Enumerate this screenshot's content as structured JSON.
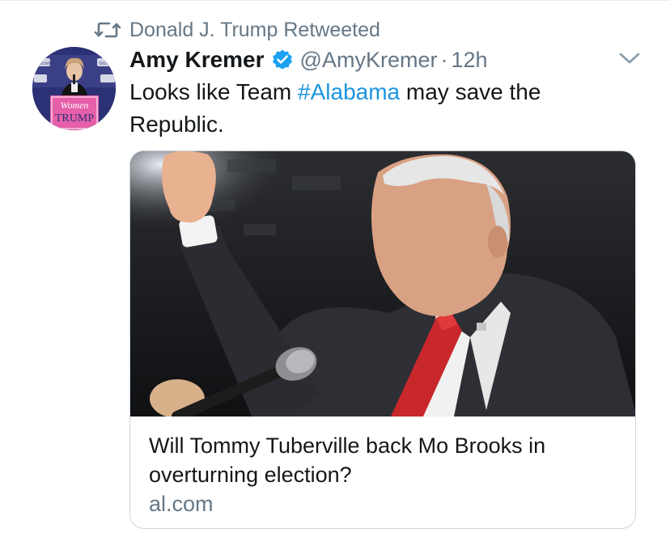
{
  "retweet_context": {
    "icon": "retweet-icon",
    "text": "Donald J. Trump Retweeted"
  },
  "author": {
    "display_name": "Amy Kremer",
    "verified_icon": "verified-badge-icon",
    "handle": "@AmyKremer",
    "separator": "·",
    "time": "12h",
    "avatar_sign_line1": "Women",
    "avatar_sign_line2": "TRUMP",
    "avatar_bg_sign_1": "Women for TRUMP",
    "avatar_bg_sign_2": "TRUMP"
  },
  "tweet": {
    "text_before": "Looks like Team ",
    "hashtag": "#Alabama",
    "text_after": " may save the Republic."
  },
  "card": {
    "title": "Will Tommy Tuberville back Mo Brooks in overturning election?",
    "domain": "al.com"
  },
  "colors": {
    "link": "#1b95e0",
    "secondary_text": "#657786",
    "primary_text": "#14171a",
    "card_border": "#ccd6dd",
    "verified_blue": "#1da1f2"
  }
}
